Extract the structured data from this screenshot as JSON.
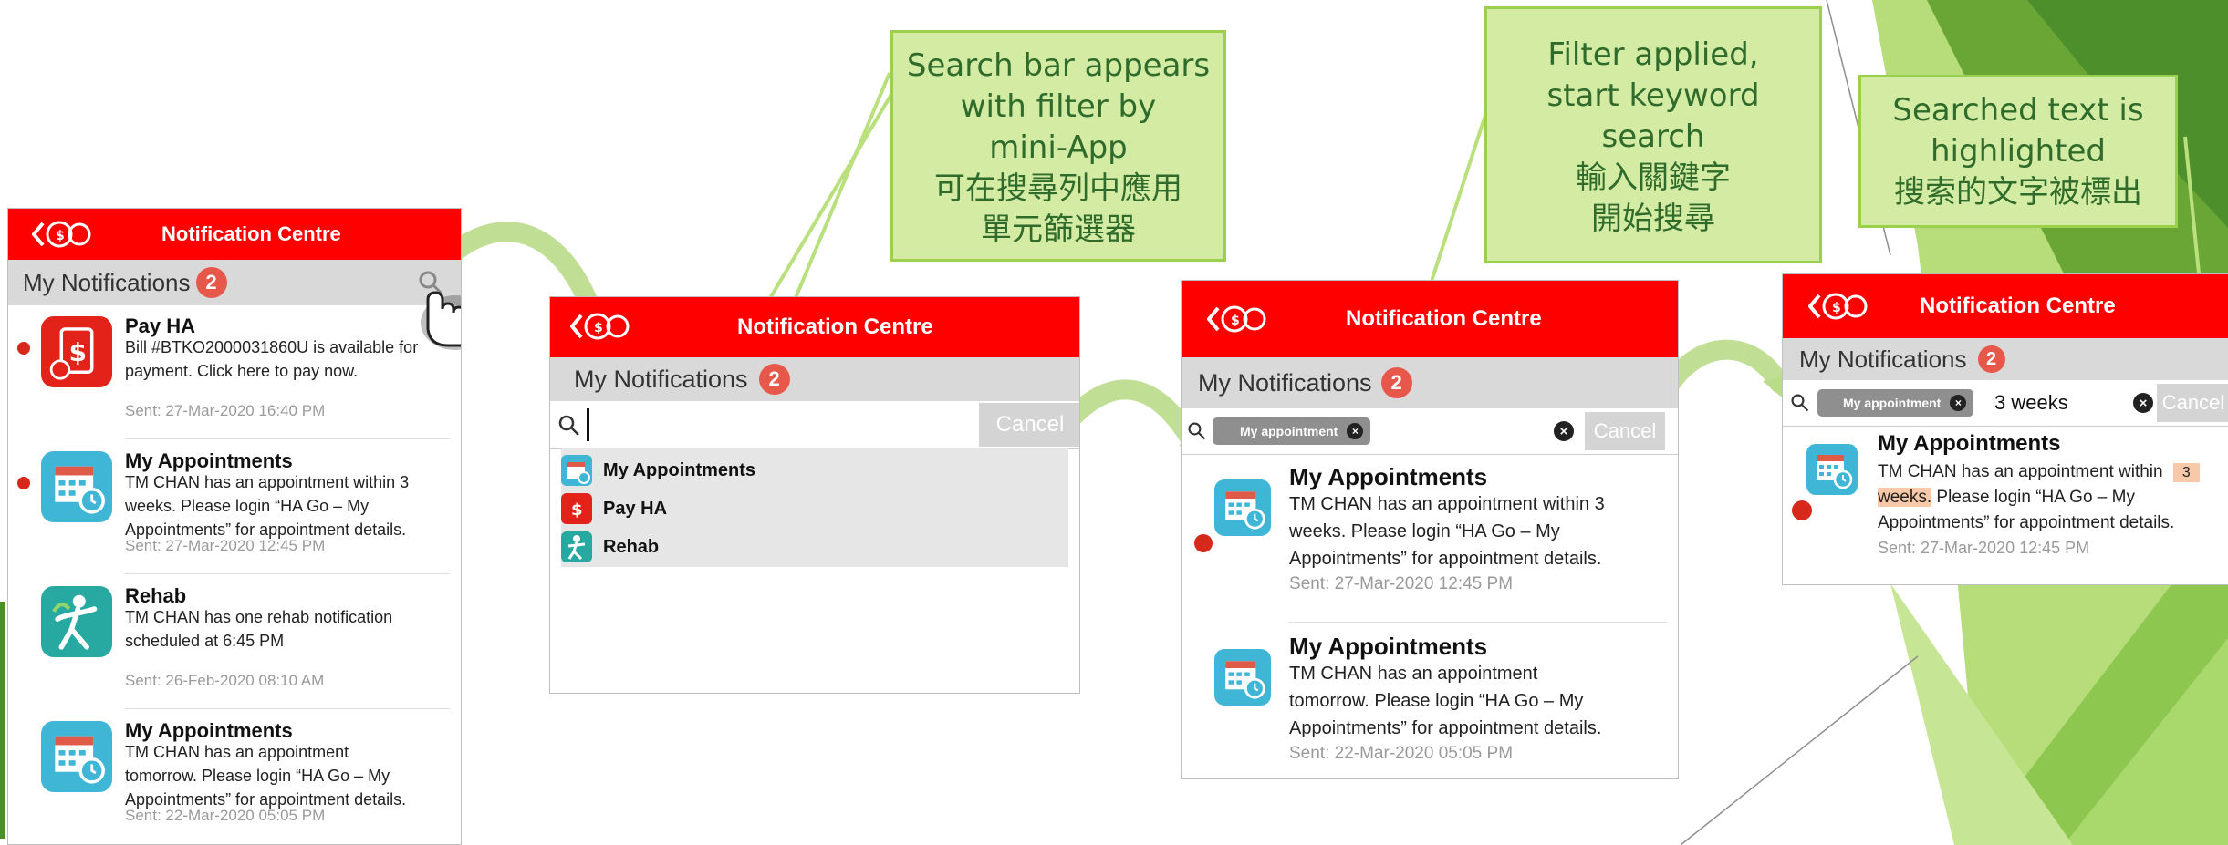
{
  "colors": {
    "header_red": "#ff0000",
    "callout_fill": "#d4eba4",
    "callout_border": "#9bd04d",
    "callout_text": "#2f6b2a",
    "badge": "#e8584a",
    "unread_dot": "#d7281c"
  },
  "callouts": {
    "c1": {
      "lines": [
        "Search bar appears",
        "with filter by",
        "mini-App",
        "可在搜尋列中應用",
        "單元篩選器"
      ]
    },
    "c2": {
      "lines": [
        "Filter applied,",
        "start keyword",
        "search",
        "輸入關鍵字",
        "開始搜尋"
      ]
    },
    "c3": {
      "lines": [
        "Searched text is",
        "highlighted",
        "搜索的文字被標出"
      ]
    }
  },
  "app": {
    "header_title": "Notification Centre",
    "section_title": "My Notifications",
    "badge_count": "2",
    "cancel_label": "Cancel"
  },
  "screen1": {
    "items": [
      {
        "title": "Pay HA",
        "lines": [
          "Bill #BTKO2000031860U is available for",
          "payment. Click here to pay now."
        ],
        "sent": "Sent: 27-Mar-2020 16:40 PM",
        "unread": true,
        "icon": "pay-ha-icon"
      },
      {
        "title": "My Appointments",
        "lines": [
          "TM CHAN has an appointment within  3",
          "weeks. Please login “HA Go – My",
          "Appointments” for appointment details."
        ],
        "sent": "Sent: 27-Mar-2020 12:45 PM",
        "unread": true,
        "icon": "appointments-icon"
      },
      {
        "title": "Rehab",
        "lines": [
          "TM CHAN has one rehab notification",
          "scheduled at 6:45 PM"
        ],
        "sent": "Sent: 26-Feb-2020 08:10 AM",
        "unread": false,
        "icon": "rehab-icon"
      },
      {
        "title": "My Appointments",
        "lines": [
          "TM CHAN has an appointment",
          "tomorrow. Please login “HA Go – My",
          "Appointments” for appointment details."
        ],
        "sent": "Sent: 22-Mar-2020 05:05 PM",
        "unread": false,
        "icon": "appointments-icon"
      }
    ]
  },
  "screen2": {
    "search_value": "",
    "filter_options": [
      "My Appointments",
      "Pay HA",
      "Rehab"
    ]
  },
  "screen3": {
    "filter_chip": "My appointment",
    "search_value": "",
    "items": [
      {
        "title": "My Appointments",
        "lines": [
          "TM CHAN has an appointment within  3",
          "weeks. Please login “HA Go – My",
          "Appointments” for appointment details."
        ],
        "sent": "Sent: 27-Mar-2020 12:45 PM",
        "unread": true
      },
      {
        "title": "My Appointments",
        "lines": [
          "TM CHAN has an appointment",
          "tomorrow. Please login “HA Go – My",
          "Appointments” for appointment details."
        ],
        "sent": "Sent: 22-Mar-2020 05:05 PM",
        "unread": false
      }
    ]
  },
  "screen4": {
    "filter_chip": "My appointment",
    "search_value": "3 weeks",
    "item": {
      "title": "My Appointments",
      "line1_prefix": "TM CHAN has an appointment within",
      "line1_highlight": "3",
      "line2_highlight": "weeks.",
      "line2_rest": " Please login “HA Go – My",
      "line3": "Appointments” for appointment details.",
      "sent": "Sent: 27-Mar-2020 12:45 PM",
      "unread": true
    }
  }
}
